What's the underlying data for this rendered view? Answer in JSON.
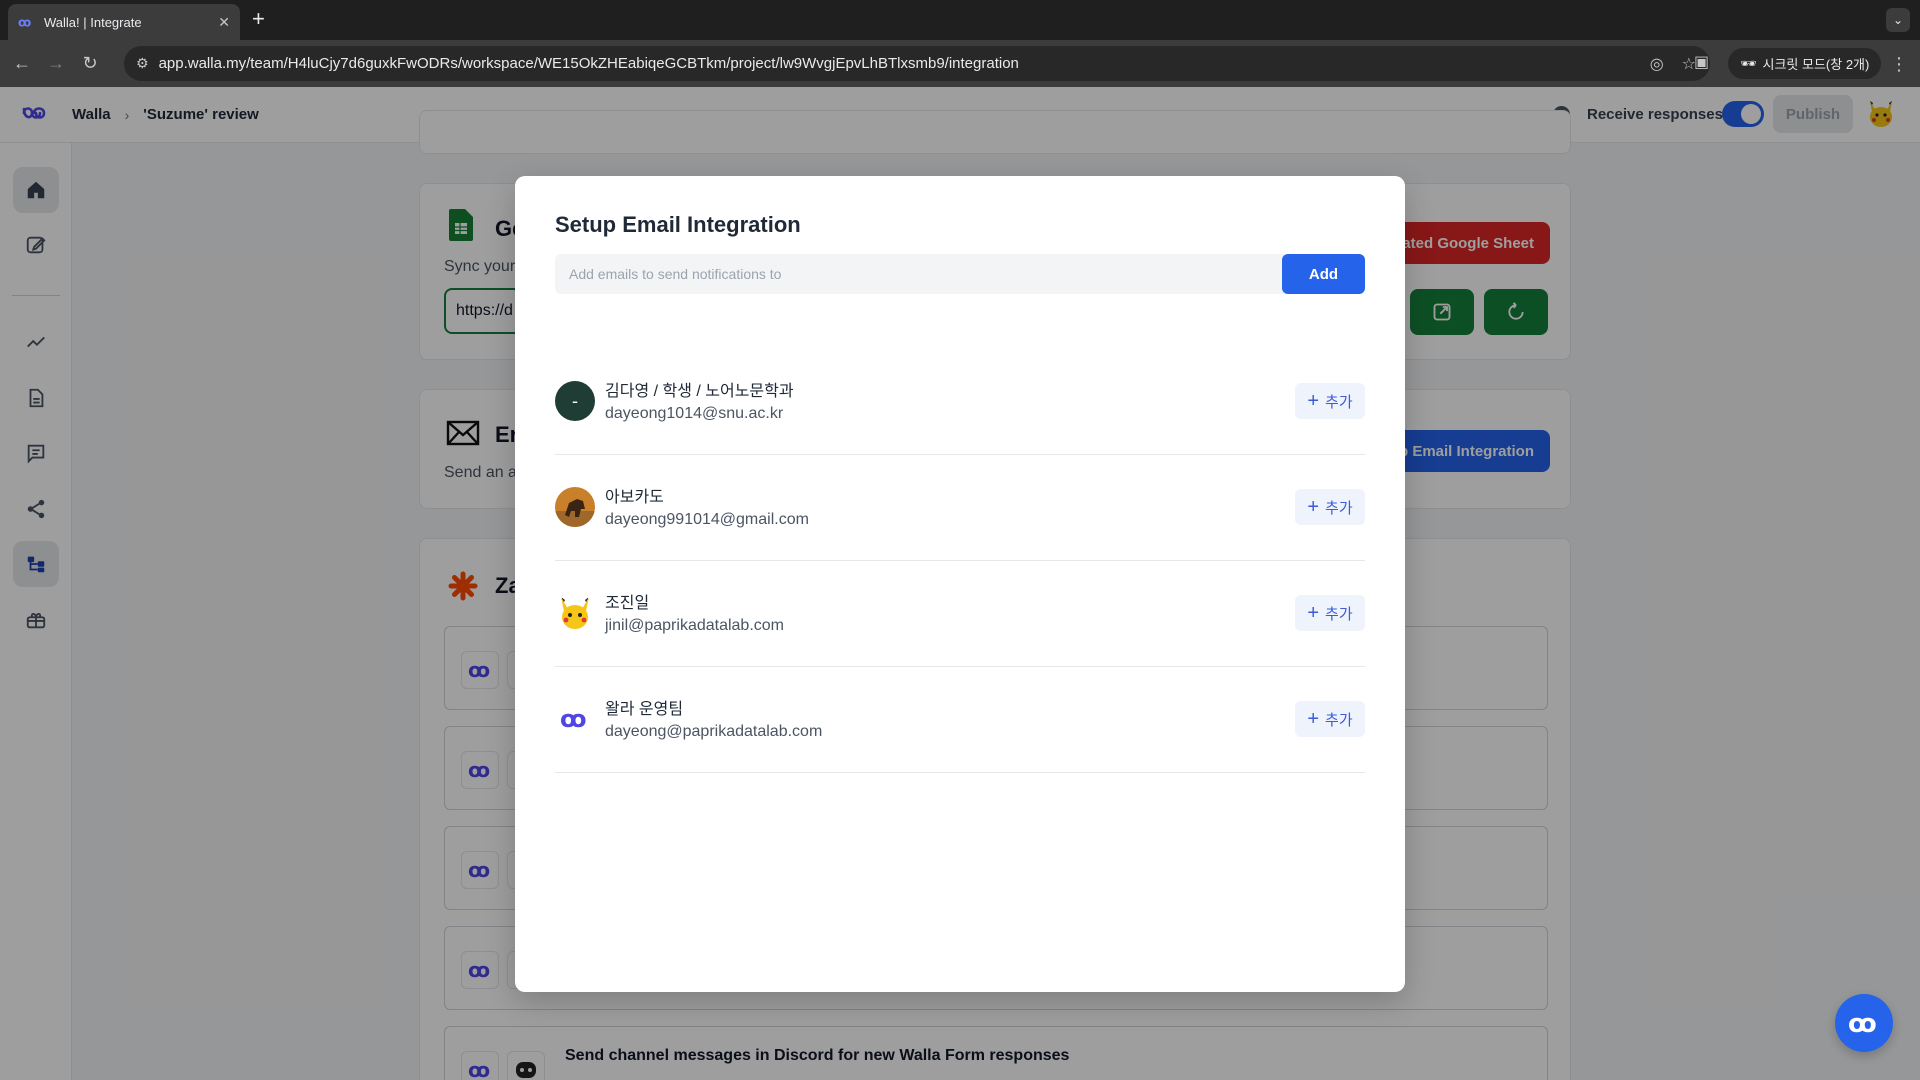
{
  "browser": {
    "tab_title": "Walla! | Integrate",
    "url": "app.walla.my/team/H4luCjy7d6guxkFwODRs/workspace/WE15OkZHEabiqeGCBTkm/project/lw9WvgjEpvLhBTlxsmb9/integration",
    "incognito_label": "시크릿 모드(창 2개)"
  },
  "header": {
    "breadcrumb_root": "Walla",
    "breadcrumb_project": "'Suzume' review",
    "receive_responses_label": "Receive responses",
    "receive_responses_on": true,
    "publish_label": "Publish"
  },
  "background": {
    "sheet_title": "Ge",
    "sheet_sub": "Sync your",
    "sheet_url": "https://d",
    "sheet_button": "rated Google Sheet",
    "email_title": "Er",
    "email_sub": "Send an a",
    "email_button": "p Email Integration",
    "zapier_title": "Za",
    "discord_row": "Send channel messages in Discord for new Walla Form responses"
  },
  "modal": {
    "title": "Setup Email Integration",
    "input_placeholder": "Add emails to send notifications to",
    "add_label": "Add",
    "contacts": [
      {
        "name": "김다영 / 학생 / 노어노문학과",
        "email": "dayeong1014@snu.ac.kr",
        "avatar": "dash",
        "add_label": "추가"
      },
      {
        "name": "아보카도",
        "email": "dayeong991014@gmail.com",
        "avatar": "horse-photo",
        "add_label": "추가"
      },
      {
        "name": "조진일",
        "email": "jinil@paprikadatalab.com",
        "avatar": "pikachu",
        "add_label": "추가"
      },
      {
        "name": "왈라 운영팀",
        "email": "dayeong@paprikadatalab.com",
        "avatar": "walla-logo",
        "add_label": "추가"
      }
    ],
    "avatar_dash_text": "-"
  },
  "colors": {
    "primary": "#2563eb",
    "danger": "#dc2626",
    "success": "#15803d"
  }
}
